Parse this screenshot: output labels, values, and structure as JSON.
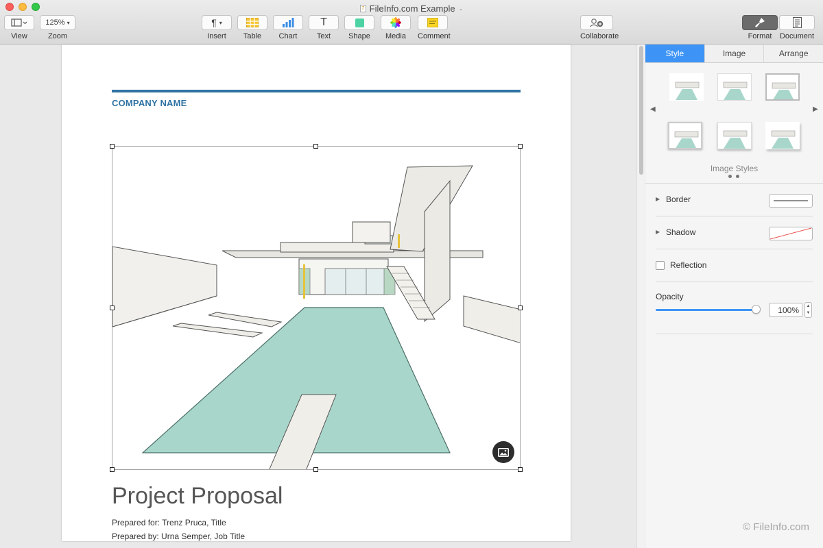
{
  "window": {
    "title": "FileInfo.com Example",
    "file_icon_glyph": "7"
  },
  "toolbar": {
    "view": {
      "label": "View"
    },
    "zoom": {
      "label": "Zoom",
      "value": "125%"
    },
    "insert": {
      "label": "Insert",
      "glyph": "¶"
    },
    "table": {
      "label": "Table"
    },
    "chart": {
      "label": "Chart"
    },
    "text": {
      "label": "Text",
      "glyph": "T"
    },
    "shape": {
      "label": "Shape"
    },
    "media": {
      "label": "Media"
    },
    "comment": {
      "label": "Comment"
    },
    "collaborate": {
      "label": "Collaborate"
    },
    "format": {
      "label": "Format"
    },
    "document": {
      "label": "Document"
    }
  },
  "document": {
    "company_name": "COMPANY NAME",
    "title": "Project Proposal",
    "prepared_for": "Prepared for: Trenz Pruca, Title",
    "prepared_by": "Prepared by: Urna Semper, Job Title"
  },
  "panel": {
    "tabs": [
      {
        "label": "Style",
        "active": true
      },
      {
        "label": "Image",
        "active": false
      },
      {
        "label": "Arrange",
        "active": false
      }
    ],
    "image_styles_label": "Image Styles",
    "border_label": "Border",
    "shadow_label": "Shadow",
    "reflection_label": "Reflection",
    "opacity_label": "Opacity",
    "opacity_value": "100%"
  },
  "watermark": "© FileInfo.com",
  "colors": {
    "accent": "#3d94f6",
    "company_blue": "#2f73a3",
    "pool": "#a9d6cb"
  }
}
